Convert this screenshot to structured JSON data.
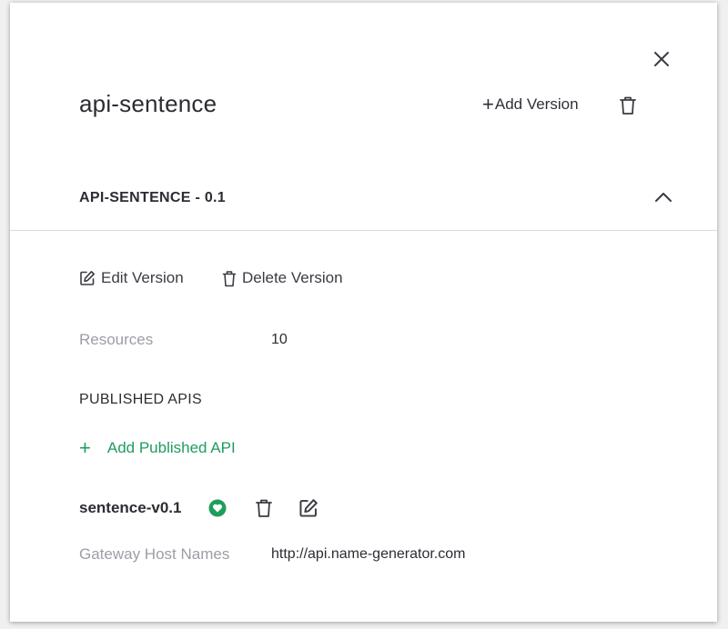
{
  "panel": {
    "title": "api-sentence",
    "add_version_plus": "+",
    "add_version_label": "Add Version"
  },
  "version": {
    "header": "API-SENTENCE - 0.1",
    "edit_label": "Edit Version",
    "delete_label": "Delete Version",
    "resources_label": "Resources",
    "resources_value": "10"
  },
  "published_apis": {
    "section_title": "PUBLISHED APIS",
    "add_plus": "+",
    "add_label": "Add Published API",
    "items": [
      {
        "name": "sentence-v0.1",
        "status_icon": "health-heart-icon",
        "gateway_label": "Gateway Host Names",
        "gateway_value": "http://api.name-generator.com"
      }
    ]
  },
  "colors": {
    "accent_green": "#1f9d5c",
    "text_dark": "#2b2d33",
    "text_muted": "#9b9ea6",
    "divider": "#dcdcdc"
  }
}
